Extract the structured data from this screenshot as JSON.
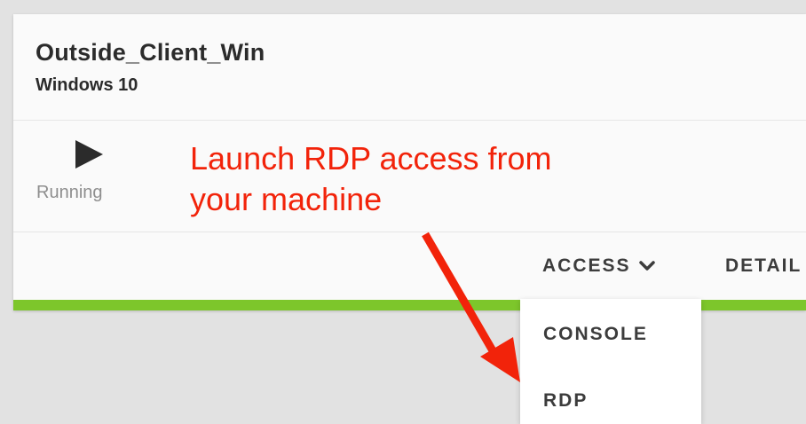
{
  "vm": {
    "name": "Outside_Client_Win",
    "os": "Windows 10",
    "status": "Running"
  },
  "toolbar": {
    "access_label": "ACCESS",
    "details_label": "DETAIL"
  },
  "access_menu": {
    "items": [
      {
        "label": "CONSOLE"
      },
      {
        "label": "RDP"
      }
    ]
  },
  "annotation": {
    "line1": "Launch RDP access from",
    "line2": "your machine"
  },
  "colors": {
    "status_bar": "#7dc62b",
    "annotation": "#f2230a",
    "text_primary": "#2b2b2b",
    "text_secondary": "#8e8e8e"
  },
  "icons": {
    "status": "play-icon",
    "dropdown": "chevron-down-icon",
    "callout": "arrow-icon"
  }
}
